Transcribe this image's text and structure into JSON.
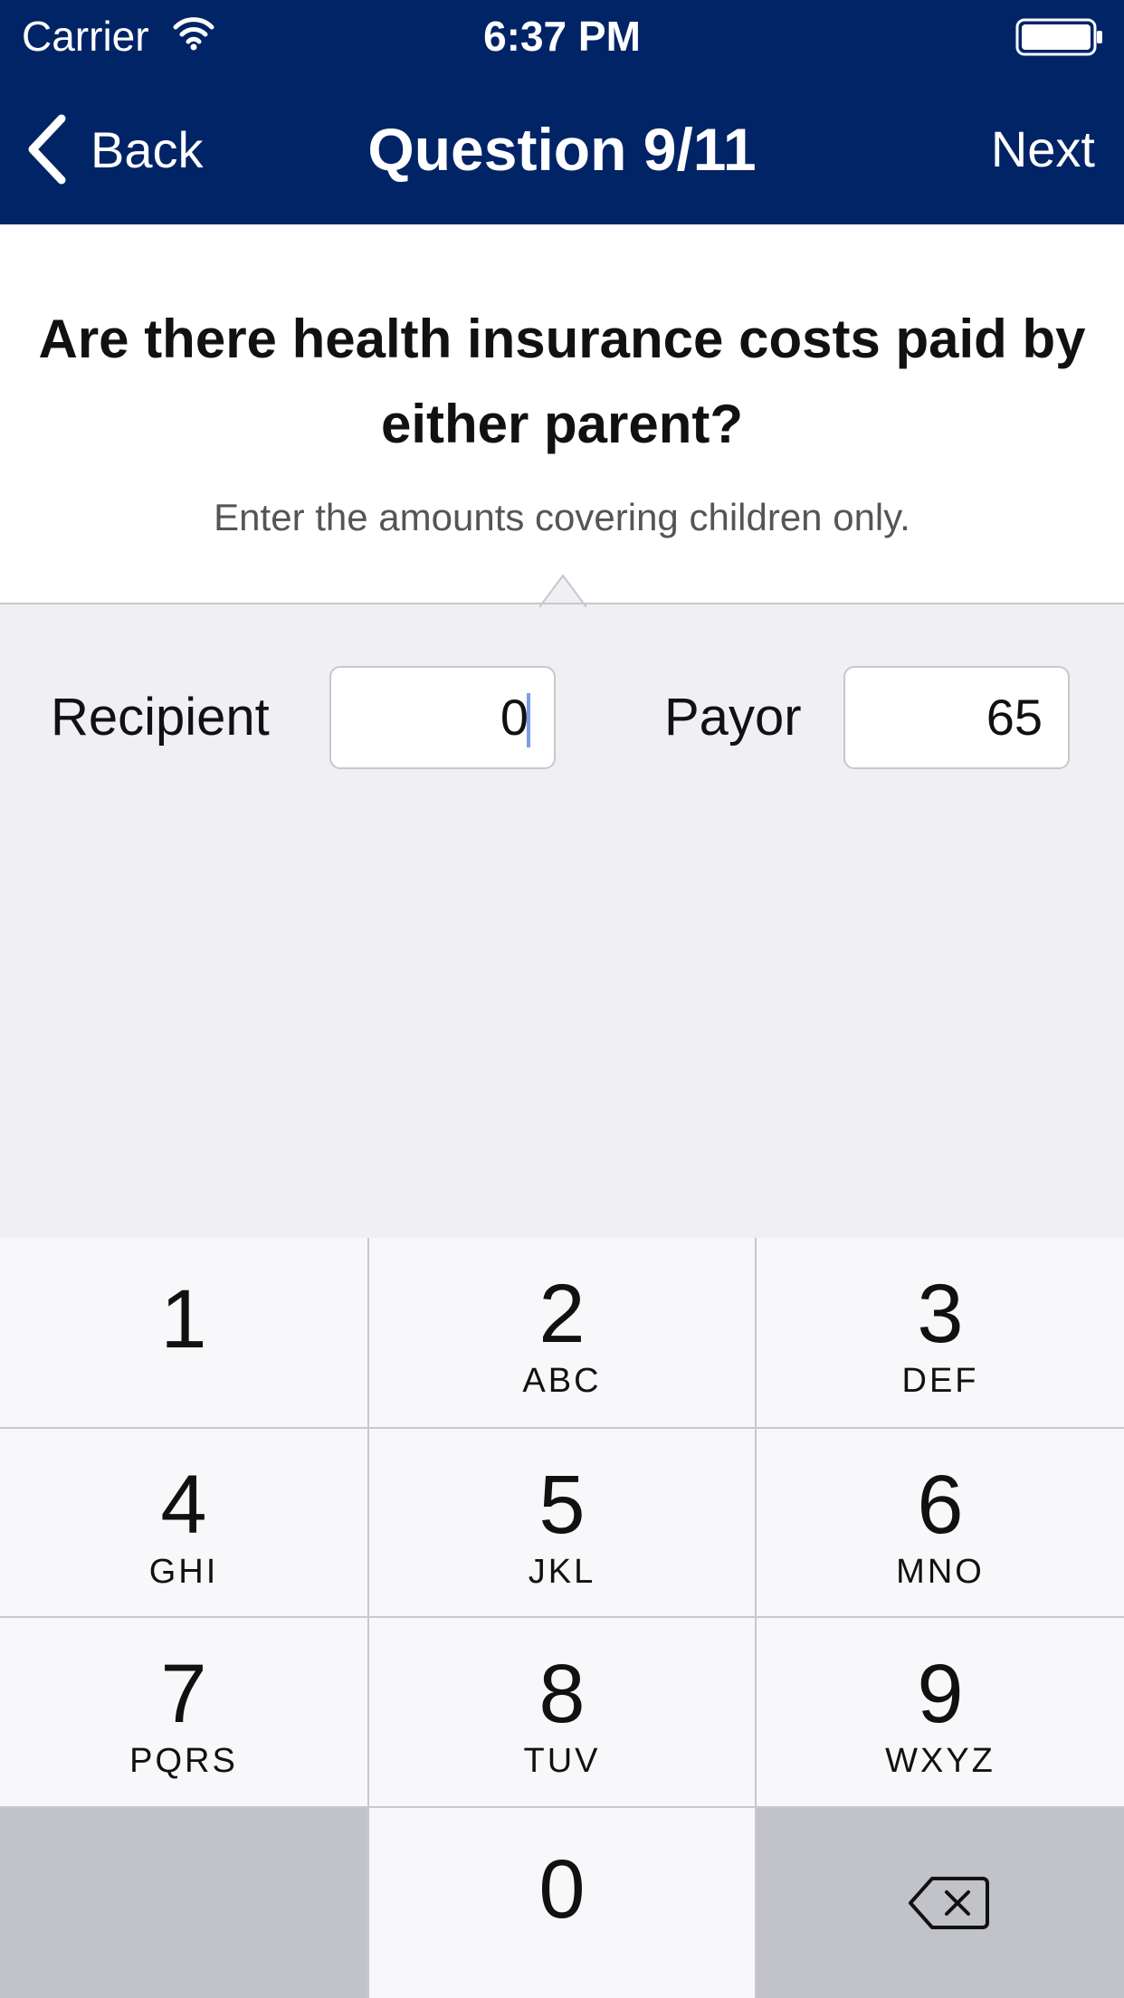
{
  "status_bar": {
    "carrier": "Carrier",
    "time": "6:37 PM"
  },
  "nav": {
    "back_label": "Back",
    "title": "Question 9/11",
    "next_label": "Next"
  },
  "question": {
    "text": "Are there health insurance costs paid by either parent?",
    "hint": "Enter the amounts covering children only."
  },
  "fields": {
    "recipient": {
      "label": "Recipient",
      "value": "0"
    },
    "payor": {
      "label": "Payor",
      "value": "65"
    }
  },
  "keypad": {
    "keys": [
      {
        "num": "1",
        "letters": ""
      },
      {
        "num": "2",
        "letters": "ABC"
      },
      {
        "num": "3",
        "letters": "DEF"
      },
      {
        "num": "4",
        "letters": "GHI"
      },
      {
        "num": "5",
        "letters": "JKL"
      },
      {
        "num": "6",
        "letters": "MNO"
      },
      {
        "num": "7",
        "letters": "PQRS"
      },
      {
        "num": "8",
        "letters": "TUV"
      },
      {
        "num": "9",
        "letters": "WXYZ"
      },
      {
        "num": "0",
        "letters": ""
      }
    ],
    "delete_icon": "delete-backspace-icon"
  },
  "colors": {
    "header_bg": "#012466",
    "page_bg": "#efeff4",
    "caret": "#7b9de8"
  }
}
